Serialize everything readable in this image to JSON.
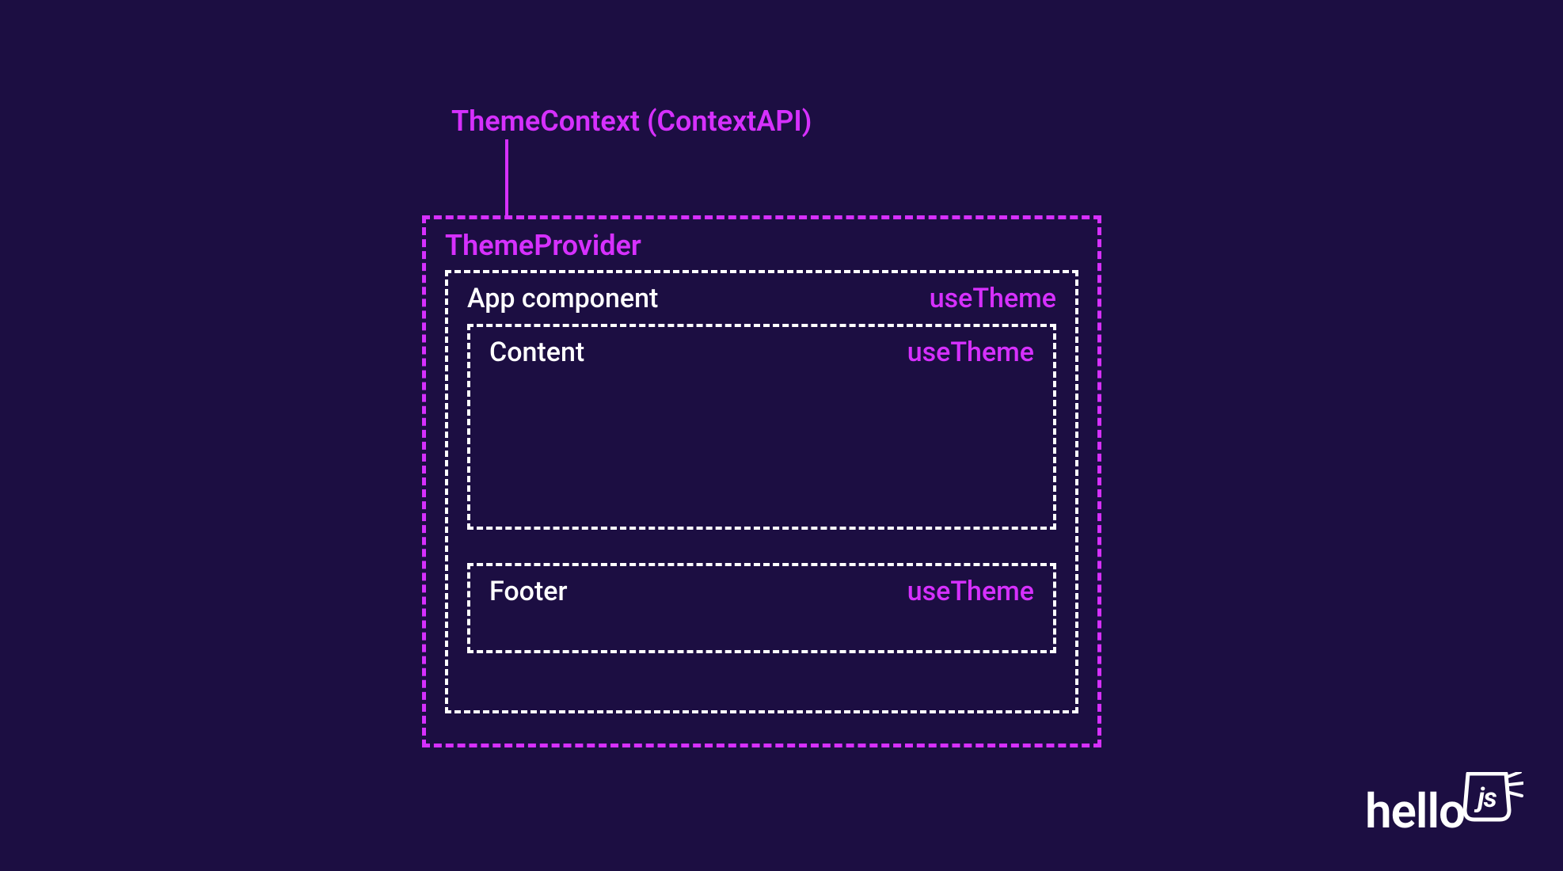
{
  "diagram": {
    "context_title": "ThemeContext (ContextAPI)",
    "provider_label": "ThemeProvider",
    "app": {
      "label": "App component",
      "hook": "useTheme",
      "content": {
        "label": "Content",
        "hook": "useTheme"
      },
      "footer": {
        "label": "Footer",
        "hook": "useTheme"
      }
    }
  },
  "brand": {
    "text": "hello",
    "suffix": "js"
  },
  "colors": {
    "background": "#1c0e42",
    "accent": "#d630ff",
    "foreground": "#ffffff"
  }
}
